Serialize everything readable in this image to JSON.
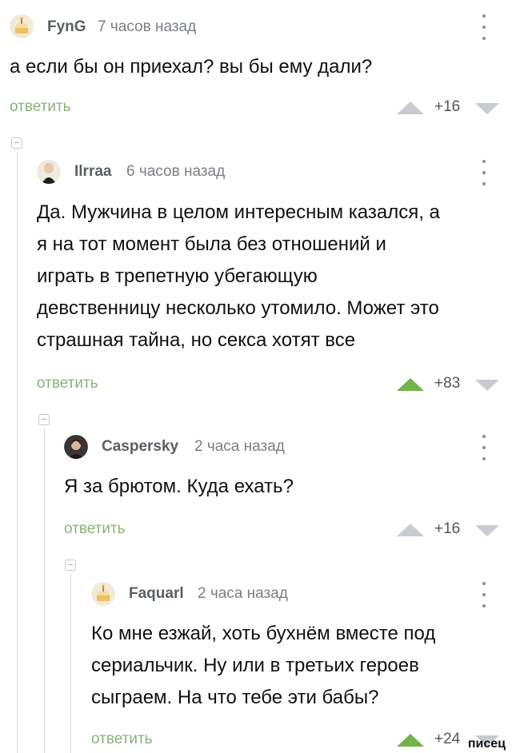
{
  "reply_label": "ответить",
  "comments": [
    {
      "username": "FynG",
      "time": "7 часов назад",
      "text": "а если бы он приехал? вы бы ему дали?",
      "score": "+16",
      "avatar": "cake-avatar-icon"
    },
    {
      "username": "Ilrraa",
      "time": "6 часов назад",
      "text": "Да. Мужчина в целом интересным казался, а\nя на тот момент была без отношений и\nиграть в трепетную убегающую\nдевственницу несколько утомило. Может это\nстрашная тайна, но секса хотят все",
      "score": "+83",
      "avatar": "user-photo-avatar"
    },
    {
      "username": "Caspersky",
      "time": "2 часа назад",
      "text": "Я за брютом. Куда ехать?",
      "score": "+16",
      "avatar": "user-photo-avatar"
    },
    {
      "username": "Faquarl",
      "time": "2 часа назад",
      "text": "Ко мне езжай, хоть бухнём вместе под\nсериальчик. Ну или в третьих героев\nсыграем. На что тебе эти бабы?",
      "score": "+24",
      "avatar": "cake-avatar-icon"
    }
  ],
  "watermark": "писец",
  "colors": {
    "reply": "#8ab27b",
    "upvote_active": "#73b34a",
    "vote_inactive": "#c8ccd0",
    "thread_line": "#d7dadd"
  }
}
